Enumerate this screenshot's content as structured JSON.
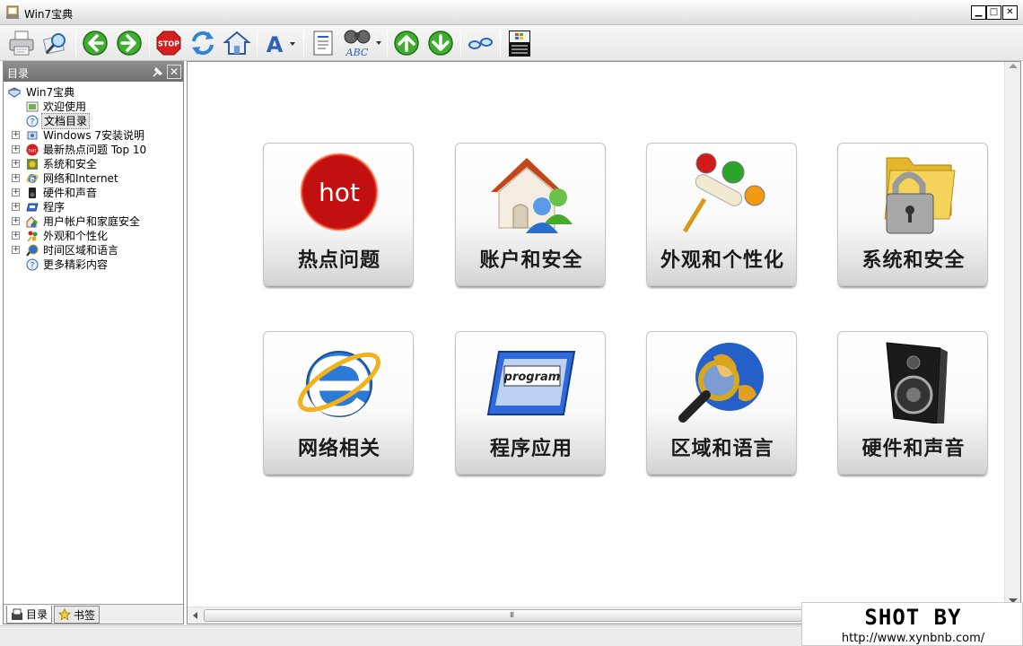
{
  "window": {
    "title": "Win7宝典"
  },
  "toolbar": {
    "buttons": [
      {
        "name": "print-button",
        "icon": "printer-icon"
      },
      {
        "name": "options-button",
        "icon": "magnifier-icon"
      },
      {
        "name": "back-button",
        "icon": "arrow-left-icon"
      },
      {
        "name": "forward-button",
        "icon": "arrow-right-icon"
      },
      {
        "name": "stop-button",
        "icon": "stop-icon",
        "text": "STOP"
      },
      {
        "name": "refresh-button",
        "icon": "refresh-icon"
      },
      {
        "name": "home-button",
        "icon": "home-icon"
      },
      {
        "name": "font-button",
        "icon": "font-icon",
        "text": "A"
      },
      {
        "name": "contents-button",
        "icon": "document-list-icon"
      },
      {
        "name": "find-button",
        "icon": "binoculars-icon",
        "text": "ABC"
      },
      {
        "name": "previous-topic-button",
        "icon": "arrow-up-icon"
      },
      {
        "name": "next-topic-button",
        "icon": "arrow-down-icon"
      },
      {
        "name": "glasses-button",
        "icon": "glasses-icon"
      },
      {
        "name": "windows-experience-button",
        "icon": "windows-logo-icon"
      }
    ]
  },
  "sidebar": {
    "title": "目录",
    "tree": [
      {
        "label": "Win7宝典",
        "level": 0,
        "expander": false,
        "icon": "book-icon"
      },
      {
        "label": "欢迎使用",
        "level": 1,
        "expander": false,
        "icon": "image-page-icon"
      },
      {
        "label": "文档目录",
        "level": 1,
        "expander": false,
        "icon": "help-page-icon",
        "selected": true
      },
      {
        "label": "Windows 7安装说明",
        "level": 1,
        "expander": true,
        "icon": "install-icon"
      },
      {
        "label": "最新热点问题 Top 10",
        "level": 1,
        "expander": true,
        "icon": "hot-icon"
      },
      {
        "label": "系统和安全",
        "level": 1,
        "expander": true,
        "icon": "security-icon"
      },
      {
        "label": "网络和Internet",
        "level": 1,
        "expander": true,
        "icon": "ie-icon"
      },
      {
        "label": "硬件和声音",
        "level": 1,
        "expander": true,
        "icon": "speaker-icon"
      },
      {
        "label": "程序",
        "level": 1,
        "expander": true,
        "icon": "program-icon"
      },
      {
        "label": "用户帐户和家庭安全",
        "level": 1,
        "expander": true,
        "icon": "users-icon"
      },
      {
        "label": "外观和个性化",
        "level": 1,
        "expander": true,
        "icon": "paint-icon"
      },
      {
        "label": "时间区域和语言",
        "level": 1,
        "expander": true,
        "icon": "globe-icon"
      },
      {
        "label": "更多精彩内容",
        "level": 1,
        "expander": false,
        "icon": "help-page-icon"
      }
    ],
    "tabs": [
      {
        "label": "目录",
        "active": true,
        "icon": "contents-icon"
      },
      {
        "label": "书签",
        "active": false,
        "icon": "star-icon"
      }
    ]
  },
  "tiles": [
    {
      "label": "热点问题",
      "icon": "hot-icon",
      "art_text": "hot"
    },
    {
      "label": "账户和安全",
      "icon": "user-house-icon"
    },
    {
      "label": "外观和个性化",
      "icon": "paint-roller-icon"
    },
    {
      "label": "系统和安全",
      "icon": "folder-lock-icon"
    },
    {
      "label": "网络相关",
      "icon": "ie-icon"
    },
    {
      "label": "程序应用",
      "icon": "program-window-icon",
      "art_text": "program"
    },
    {
      "label": "区域和语言",
      "icon": "globe-magnifier-icon"
    },
    {
      "label": "硬件和声音",
      "icon": "speaker-icon"
    }
  ],
  "watermark": {
    "line1": "SHOT BY",
    "line2": "http://www.xynbnb.com/"
  }
}
